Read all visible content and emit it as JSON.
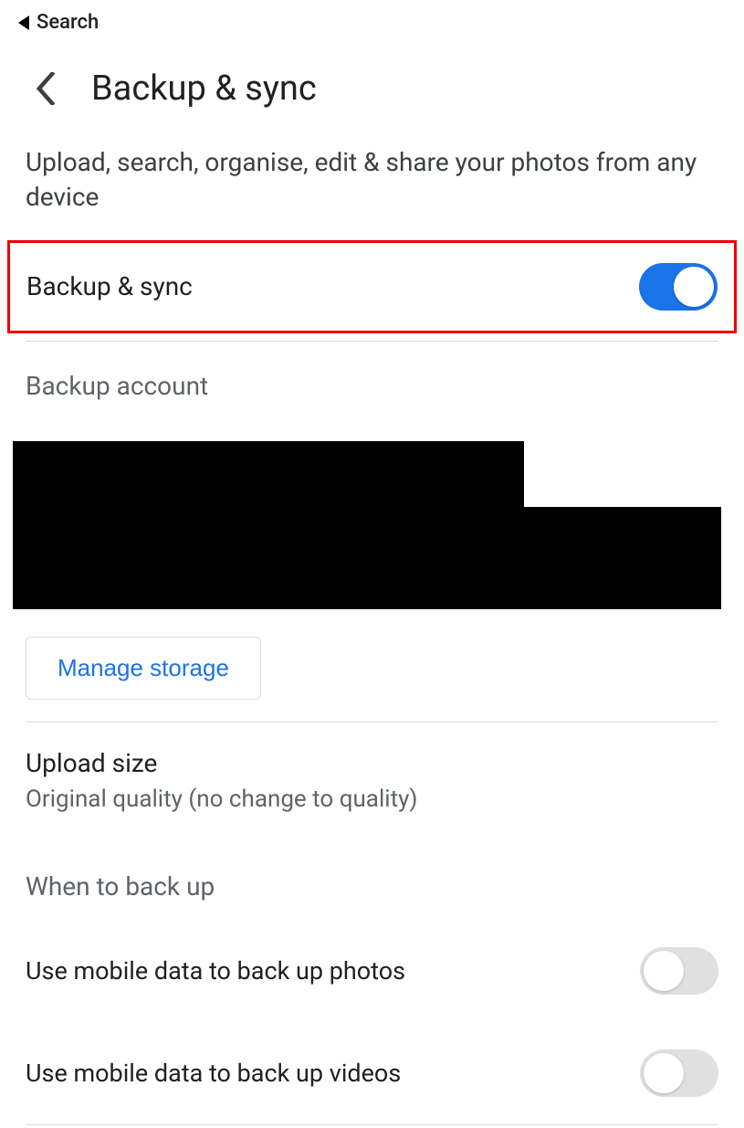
{
  "status_bar": {
    "back_label": "Search"
  },
  "header": {
    "title": "Backup & sync"
  },
  "description": "Upload, search, organise, edit & share your photos from any device",
  "backup_toggle": {
    "label": "Backup & sync",
    "on": true
  },
  "backup_account": {
    "label": "Backup account"
  },
  "manage_storage": {
    "label": "Manage storage"
  },
  "upload_size": {
    "title": "Upload size",
    "subtitle": "Original quality (no change to quality)"
  },
  "when_section": {
    "label": "When to back up"
  },
  "mobile_photos": {
    "label": "Use mobile data to back up photos",
    "on": false
  },
  "mobile_videos": {
    "label": "Use mobile data to back up videos",
    "on": false
  }
}
